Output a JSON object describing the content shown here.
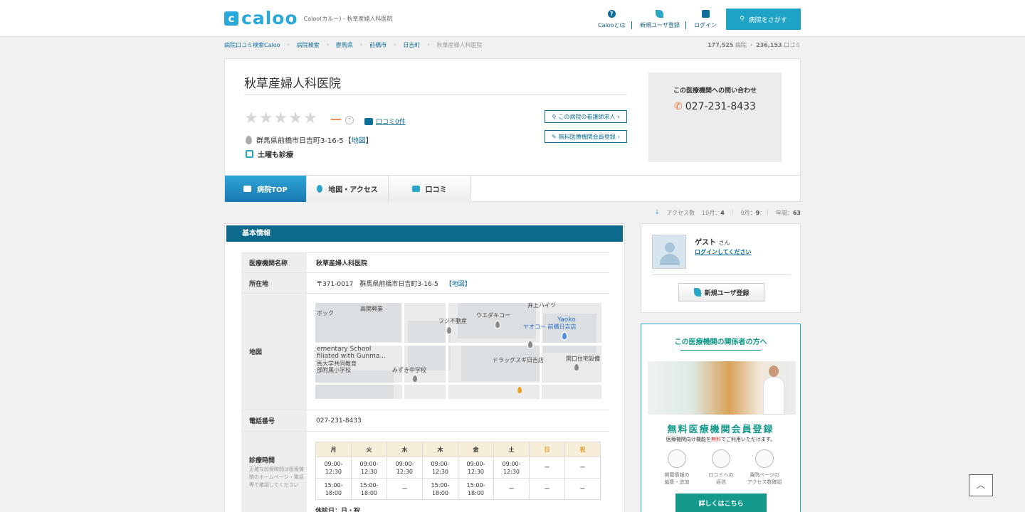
{
  "header": {
    "logo_mark": "c",
    "logo": "caloo",
    "tagline": "Caloo(カルー) - 秋草産婦人科医院",
    "nav": [
      {
        "label": "Calooとは",
        "icon": "question-icon"
      },
      {
        "label": "新規ユーザ登録",
        "icon": "leaf-icon"
      },
      {
        "label": "ログイン",
        "icon": "lock-icon"
      }
    ],
    "search_button": "病院をさがす"
  },
  "breadcrumb": [
    "病院口コミ検索Caloo",
    "病院検索",
    "群馬県",
    "前橋市",
    "日吉町"
  ],
  "breadcrumb_current": "秋草産婦人科医院",
  "counts": {
    "hospitals": "177,525",
    "hospitals_unit": "病院 ・",
    "reviews": "236,153",
    "reviews_unit": "口コミ"
  },
  "hospital": {
    "name": "秋草産婦人科医院",
    "rating_dash": "ー",
    "review_link": "口コミ0件",
    "address": "群馬県前橋市日吉町3-16-5",
    "map_link_open": "【",
    "map_link": "地図",
    "map_link_close": "】",
    "saturday": "土曜も診療",
    "nurse_link": "この病院の看護師求人",
    "member_link": "無料医療機関会員登録",
    "contact_title": "この医療機関への問い合わせ",
    "phone": "027-231-8433"
  },
  "tabs": [
    {
      "label": "病院TOP",
      "active": true
    },
    {
      "label": "地図・アクセス",
      "active": false
    },
    {
      "label": "口コミ",
      "active": false
    }
  ],
  "access": {
    "label": "アクセス数",
    "oct": "10月：",
    "oct_val": "4",
    "sep": "|",
    "sep_val": "9月：",
    "sep_count": "9",
    "year": "年間：",
    "year_val": "63"
  },
  "basic": {
    "title": "基本情報",
    "name_label": "医療機関名称",
    "name_value": "秋草産婦人科医院",
    "addr_label": "所在地",
    "addr_value": "〒371-0017　群馬県前橋市日吉町3-16-5",
    "addr_map": "【地図】",
    "map_label": "地図",
    "phone_label": "電話番号",
    "phone_value": "027-231-8433",
    "hours_label": "診療時間",
    "hours_note": "正確な診療時間は医療機関のホームページ・電話等で確認してください",
    "days": [
      "月",
      "火",
      "水",
      "木",
      "金",
      "土",
      "日",
      "祝"
    ],
    "morning": [
      "09:00-\n12:30",
      "09:00-\n12:30",
      "09:00-\n12:30",
      "09:00-\n12:30",
      "09:00-\n12:30",
      "09:00-\n12:30",
      "ー",
      "ー"
    ],
    "afternoon": [
      "15:00-\n18:00",
      "15:00-\n18:00",
      "ー",
      "15:00-\n18:00",
      "15:00-\n18:00",
      "ー",
      "ー",
      "ー"
    ],
    "closed": "休診日：日・祝"
  },
  "map": {
    "labels": [
      "ボック",
      "高関興業",
      "フジ不動産",
      "ウエダキコー",
      "井上ハイツ",
      "Yaoko",
      "ヤオコー 前橋日吉店",
      "ementary School",
      "filiated with Gunma...",
      "馬大学共同教育",
      "部附属小学校",
      "みずき中学校",
      "ドラッグスギ日吉店",
      "関口住宅設備"
    ]
  },
  "user": {
    "name": "ゲスト",
    "honorific": "さん",
    "login": "ログインしてください",
    "register": "新規ユーザ登録"
  },
  "promo": {
    "title": "この医療機関の関係者の方へ",
    "headline": "無料医療機関会員登録",
    "sub_pre": "医療機関向け機能を",
    "sub_red": "無料",
    "sub_post": "でご利用いただけます。",
    "features": [
      "掲載情報の\n編集・追加",
      "口コミへの\n返信",
      "貴院ページの\nアクセス数確認"
    ],
    "button": "詳しくはこちら"
  },
  "colors": {
    "accent": "#1ea3c6",
    "header_bar": "#0d6a8c",
    "promo": "#139a8c",
    "weekend": "#e39b2c"
  }
}
